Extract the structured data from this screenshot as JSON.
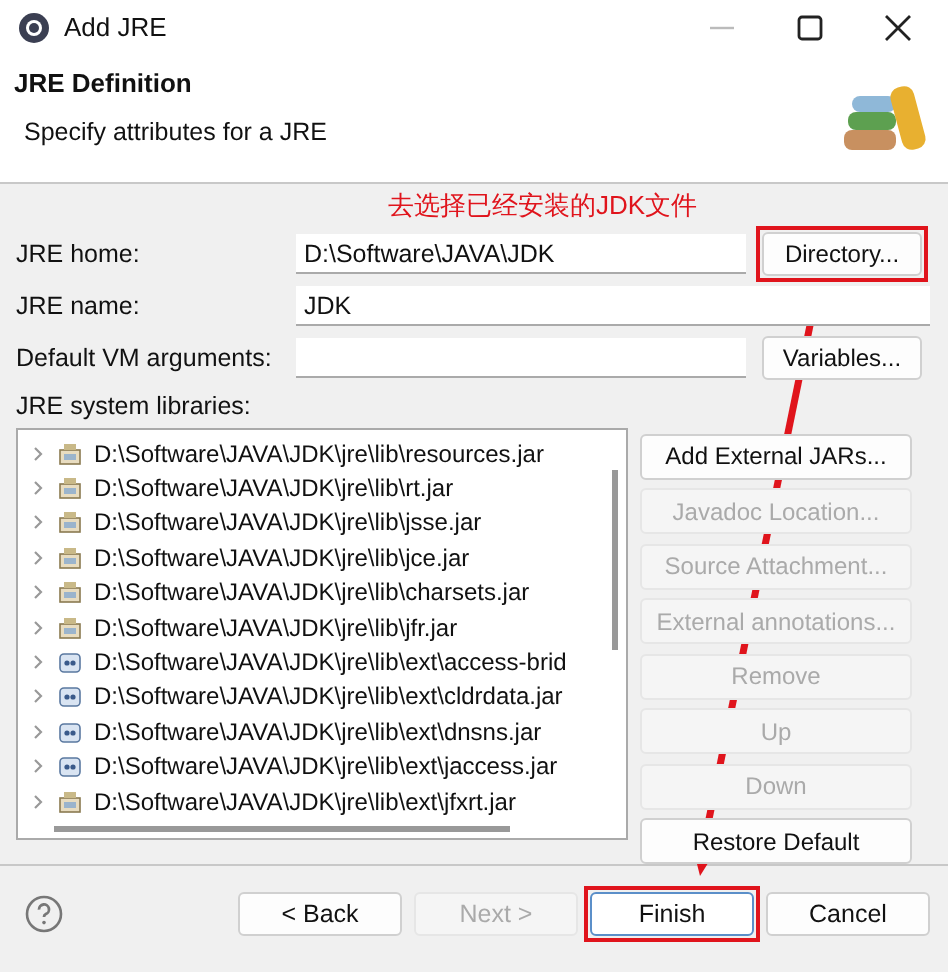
{
  "window": {
    "title": "Add JRE"
  },
  "header": {
    "title": "JRE Definition",
    "subtitle": "Specify attributes for a JRE"
  },
  "annotation": {
    "text": "去选择已经安装的JDK文件"
  },
  "fields": [
    {
      "label": "JRE home:",
      "value": "D:\\Software\\JAVA\\JDK",
      "button": {
        "label": "Directory...",
        "disabled": false,
        "highlighted": true
      }
    },
    {
      "label": "JRE name:",
      "value": "JDK"
    },
    {
      "label": "Default VM arguments:",
      "button": {
        "label": "Variables...",
        "disabled": false,
        "highlighted": false
      }
    }
  ],
  "libraries": {
    "label": "JRE system libraries:",
    "items": [
      {
        "path": "D:\\Software\\JAVA\\JDK\\jre\\lib\\resources.jar",
        "kind": "jar",
        "expanded": false
      },
      {
        "path": "D:\\Software\\JAVA\\JDK\\jre\\lib\\rt.jar",
        "kind": "jar",
        "expanded": false
      },
      {
        "path": "D:\\Software\\JAVA\\JDK\\jre\\lib\\jsse.jar",
        "kind": "jar",
        "expanded": false
      },
      {
        "path": "D:\\Software\\JAVA\\JDK\\jre\\lib\\jce.jar",
        "kind": "jar",
        "expanded": false
      },
      {
        "path": "D:\\Software\\JAVA\\JDK\\jre\\lib\\charsets.jar",
        "kind": "jar",
        "expanded": false
      },
      {
        "path": "D:\\Software\\JAVA\\JDK\\jre\\lib\\jfr.jar",
        "kind": "jar",
        "expanded": false
      },
      {
        "path": "D:\\Software\\JAVA\\JDK\\jre\\lib\\ext\\access-brid",
        "kind": "ext",
        "expanded": false
      },
      {
        "path": "D:\\Software\\JAVA\\JDK\\jre\\lib\\ext\\cldrdata.jar",
        "kind": "ext",
        "expanded": false
      },
      {
        "path": "D:\\Software\\JAVA\\JDK\\jre\\lib\\ext\\dnsns.jar",
        "kind": "ext",
        "expanded": false
      },
      {
        "path": "D:\\Software\\JAVA\\JDK\\jre\\lib\\ext\\jaccess.jar",
        "kind": "ext",
        "expanded": false
      },
      {
        "path": "D:\\Software\\JAVA\\JDK\\jre\\lib\\ext\\jfxrt.jar",
        "kind": "jar",
        "expanded": false
      }
    ],
    "buttons": [
      {
        "label": "Add External JARs...",
        "disabled": false
      },
      {
        "label": "Javadoc Location...",
        "disabled": true
      },
      {
        "label": "Source Attachment...",
        "disabled": true
      },
      {
        "label": "External annotations...",
        "disabled": true
      },
      {
        "label": "Remove",
        "disabled": true
      },
      {
        "label": "Up",
        "disabled": true
      },
      {
        "label": "Down",
        "disabled": true
      },
      {
        "label": "Restore Default",
        "disabled": false
      }
    ]
  },
  "footer": {
    "buttons": [
      {
        "label": "< Back",
        "disabled": false,
        "default": false,
        "highlighted": false
      },
      {
        "label": "Next >",
        "disabled": true,
        "default": false,
        "highlighted": false
      },
      {
        "label": "Finish",
        "disabled": false,
        "default": true,
        "highlighted": true
      },
      {
        "label": "Cancel",
        "disabled": false,
        "default": false,
        "highlighted": false
      }
    ]
  }
}
